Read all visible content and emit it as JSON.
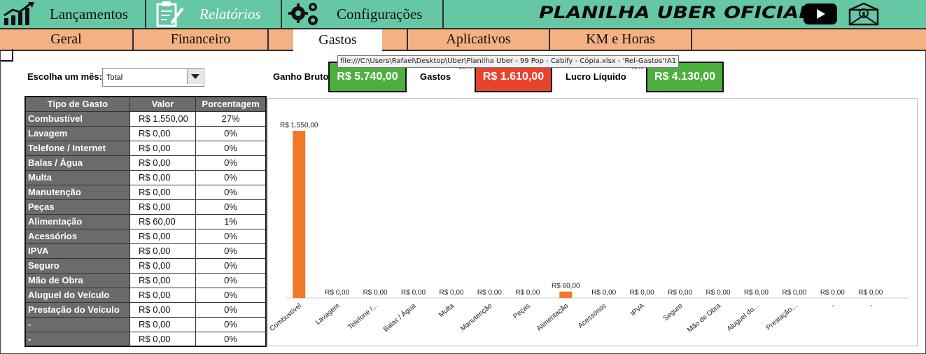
{
  "nav": {
    "lancamentos": "Lançamentos",
    "relatorios": "Relatórios",
    "configuracoes": "Configurações",
    "brand": "PLANILHA UBER OFICIAL"
  },
  "tabs": [
    "Geral",
    "Financeiro",
    "Gastos",
    "Aplicativos",
    "KM e Horas"
  ],
  "active_tab": "Gastos",
  "tooltip": "file:///C:\\Users\\Rafael\\Desktop\\Uber\\Planilha Uber - 99 Pop - Cabify - Cópia.xlsx - 'Rel-Gastos'!A1",
  "filter": {
    "label": "Escolha um mês:",
    "value": "Total"
  },
  "kpis": {
    "ganho_label": "Ganho Bruto",
    "ganho_value": "R$  5.740,00",
    "gastos_label": "Gastos",
    "gastos_value": "R$  1.610,00",
    "gastos_pct": "28%",
    "lucro_label": "Lucro Líquido",
    "lucro_value": "R$  4.130,00",
    "lucro_pct": "72%"
  },
  "colors": {
    "green": "#4caf3e",
    "red": "#e8432e",
    "nav": "#66c7a5",
    "tabs": "#f4b183",
    "bar": "#f07a2a"
  },
  "table": {
    "headers": [
      "Tipo de Gasto",
      "Valor",
      "Porcentagem"
    ],
    "rows": [
      [
        "Combustível",
        "R$ 1.550,00",
        "27%"
      ],
      [
        "Lavagem",
        "R$ 0,00",
        "0%"
      ],
      [
        "Telefone / Internet",
        "R$ 0,00",
        "0%"
      ],
      [
        "Balas / Água",
        "R$ 0,00",
        "0%"
      ],
      [
        "Multa",
        "R$ 0,00",
        "0%"
      ],
      [
        "Manutenção",
        "R$ 0,00",
        "0%"
      ],
      [
        "Peças",
        "R$ 0,00",
        "0%"
      ],
      [
        "Alimentação",
        "R$ 60,00",
        "1%"
      ],
      [
        "Acessórios",
        "R$ 0,00",
        "0%"
      ],
      [
        "IPVA",
        "R$ 0,00",
        "0%"
      ],
      [
        "Seguro",
        "R$ 0,00",
        "0%"
      ],
      [
        "Mão de Obra",
        "R$ 0,00",
        "0%"
      ],
      [
        "Aluguel do Veículo",
        "R$ 0,00",
        "0%"
      ],
      [
        "Prestação do Veículo",
        "R$ 0,00",
        "0%"
      ],
      [
        "-",
        "R$ 0,00",
        "0%"
      ],
      [
        "-",
        "R$ 0,00",
        "0%"
      ]
    ]
  },
  "chart_data": {
    "type": "bar",
    "categories": [
      "Combustível",
      "Lavagem",
      "Telefone /...",
      "Balas / Água",
      "Multa",
      "Manutenção",
      "Peças",
      "Alimentação",
      "Acessórios",
      "IPVA",
      "Seguro",
      "Mão de Obra",
      "Aluguel do...",
      "Prestação...",
      "-",
      "-"
    ],
    "values": [
      1550,
      0,
      0,
      0,
      0,
      0,
      0,
      60,
      0,
      0,
      0,
      0,
      0,
      0,
      0,
      0
    ],
    "data_labels": [
      "R$ 1.550,00",
      "R$ 0,00",
      "R$ 0,00",
      "R$ 0,00",
      "R$ 0,00",
      "R$ 0,00",
      "R$ 0,00",
      "R$ 60,00",
      "R$ 0,00",
      "R$ 0,00",
      "R$ 0,00",
      "R$ 0,00",
      "R$ 0,00",
      "R$ 0,00",
      "R$ 0,00",
      "R$ 0,00"
    ],
    "title": "",
    "xlabel": "",
    "ylabel": "",
    "grid": false,
    "legend": "none"
  }
}
